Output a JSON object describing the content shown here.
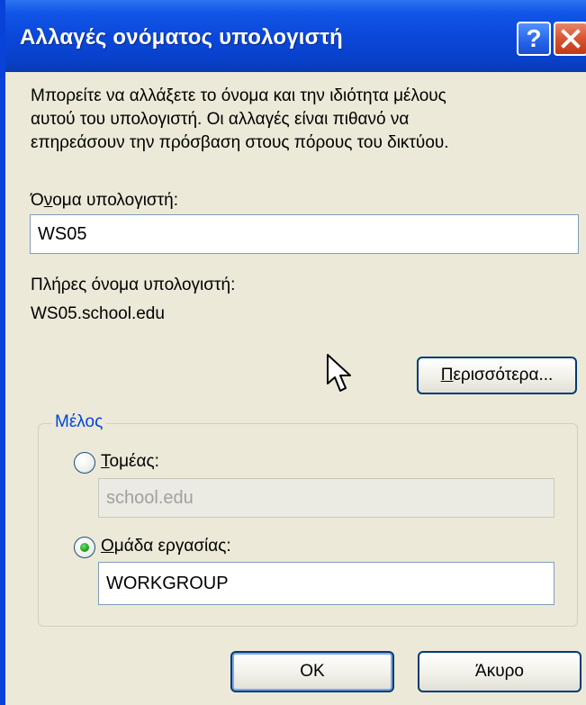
{
  "window": {
    "title": "Αλλαγές ονόματος υπολογιστή",
    "help_glyph": "?",
    "close_icon": "close-x-icon"
  },
  "intro_text": [
    "Μπορείτε να αλλάξετε το όνομα και την ιδιότητα μέλους",
    "αυτού του υπολογιστή. Οι αλλαγές είναι πιθανό να",
    "επηρεάσουν την πρόσβαση στους πόρους του δικτύου."
  ],
  "computer_name": {
    "label_prefix": "Ό",
    "label_access": "ν",
    "label_suffix": "ομα υπολογιστή:",
    "value": "WS05"
  },
  "full_name": {
    "label": "Πλήρες όνομα υπολογιστή:",
    "value": "WS05.school.edu"
  },
  "more_button": {
    "label_access": "Π",
    "label_rest": "ερισσότερα..."
  },
  "member_of": {
    "legend": "Μέλος",
    "domain": {
      "label_access": "Τ",
      "label_rest": "ομέας:",
      "value": "school.edu",
      "selected": false,
      "enabled": false
    },
    "workgroup": {
      "label_access": "Ο",
      "label_rest": "μάδα εργασίας:",
      "value": "WORKGROUP",
      "selected": true
    }
  },
  "buttons": {
    "ok": "OK",
    "cancel": "Άκυρο"
  },
  "colors": {
    "titlebar": "#0A46D8",
    "dialog_bg": "#ECE9D8",
    "legend_text": "#0046D5",
    "close_button": "#D8542F",
    "radio_selected": "#21A121"
  }
}
